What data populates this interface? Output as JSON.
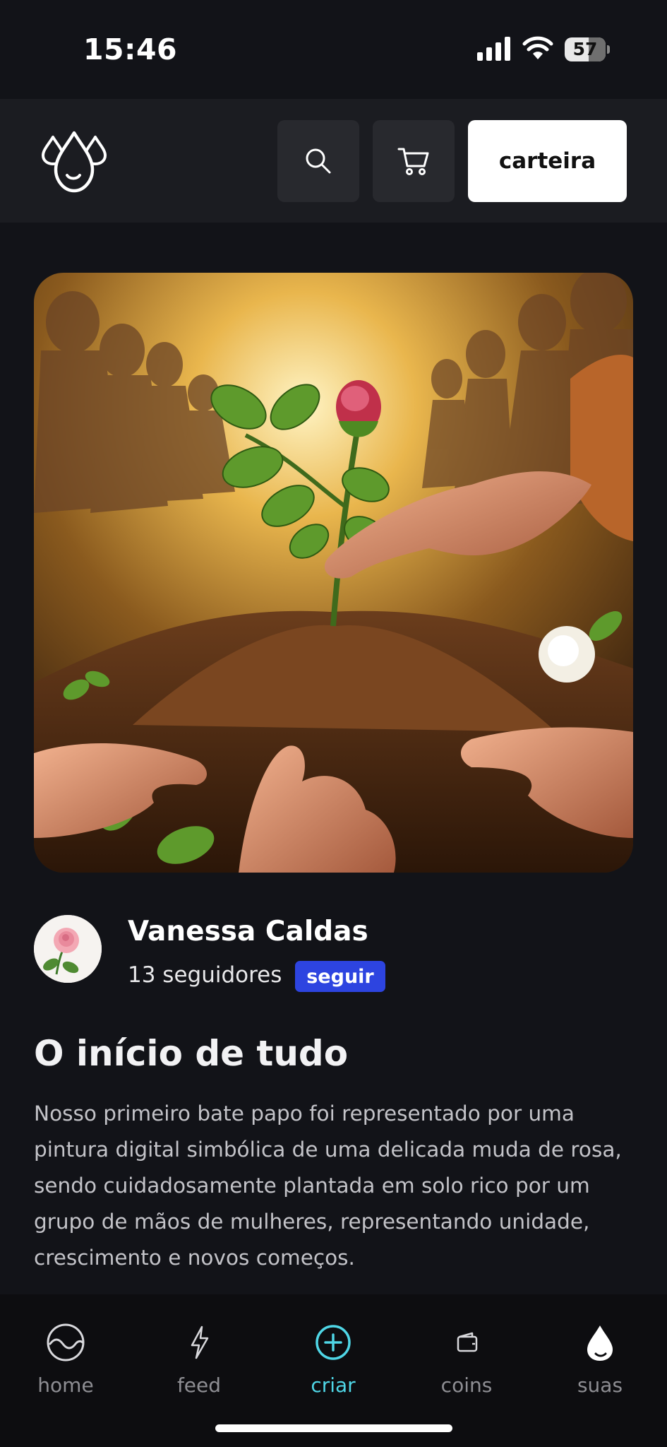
{
  "status_bar": {
    "time": "15:46",
    "battery": "57"
  },
  "header": {
    "logo_icon": "droplets-icon",
    "search_icon": "search-icon",
    "cart_icon": "cart-icon",
    "wallet_label": "carteira"
  },
  "post": {
    "image_description_icon": "rose-planting-image",
    "author": {
      "name": "Vanessa Caldas",
      "followers": "13 seguidores",
      "follow_label": "seguir"
    },
    "title": "O início de tudo",
    "body": "Nosso primeiro bate papo foi representado por uma pintura digital simbólica de uma delicada muda de rosa, sendo cuidadosamente plantada em solo rico por um grupo de mãos de mulheres, representando unidade, crescimento e novos começos."
  },
  "nav": {
    "items": [
      {
        "label": "home",
        "icon": "wave-circle-icon",
        "active": false
      },
      {
        "label": "feed",
        "icon": "lightning-icon",
        "active": false
      },
      {
        "label": "criar",
        "icon": "plus-circle-icon",
        "active": true
      },
      {
        "label": "coins",
        "icon": "wallet-icon",
        "active": false
      },
      {
        "label": "suas",
        "icon": "drop-icon",
        "active": false
      }
    ]
  },
  "colors": {
    "background": "#121318",
    "header_bg": "#1b1c21",
    "accent_active": "#4fd6e6",
    "follow_button": "#2d44e0"
  }
}
